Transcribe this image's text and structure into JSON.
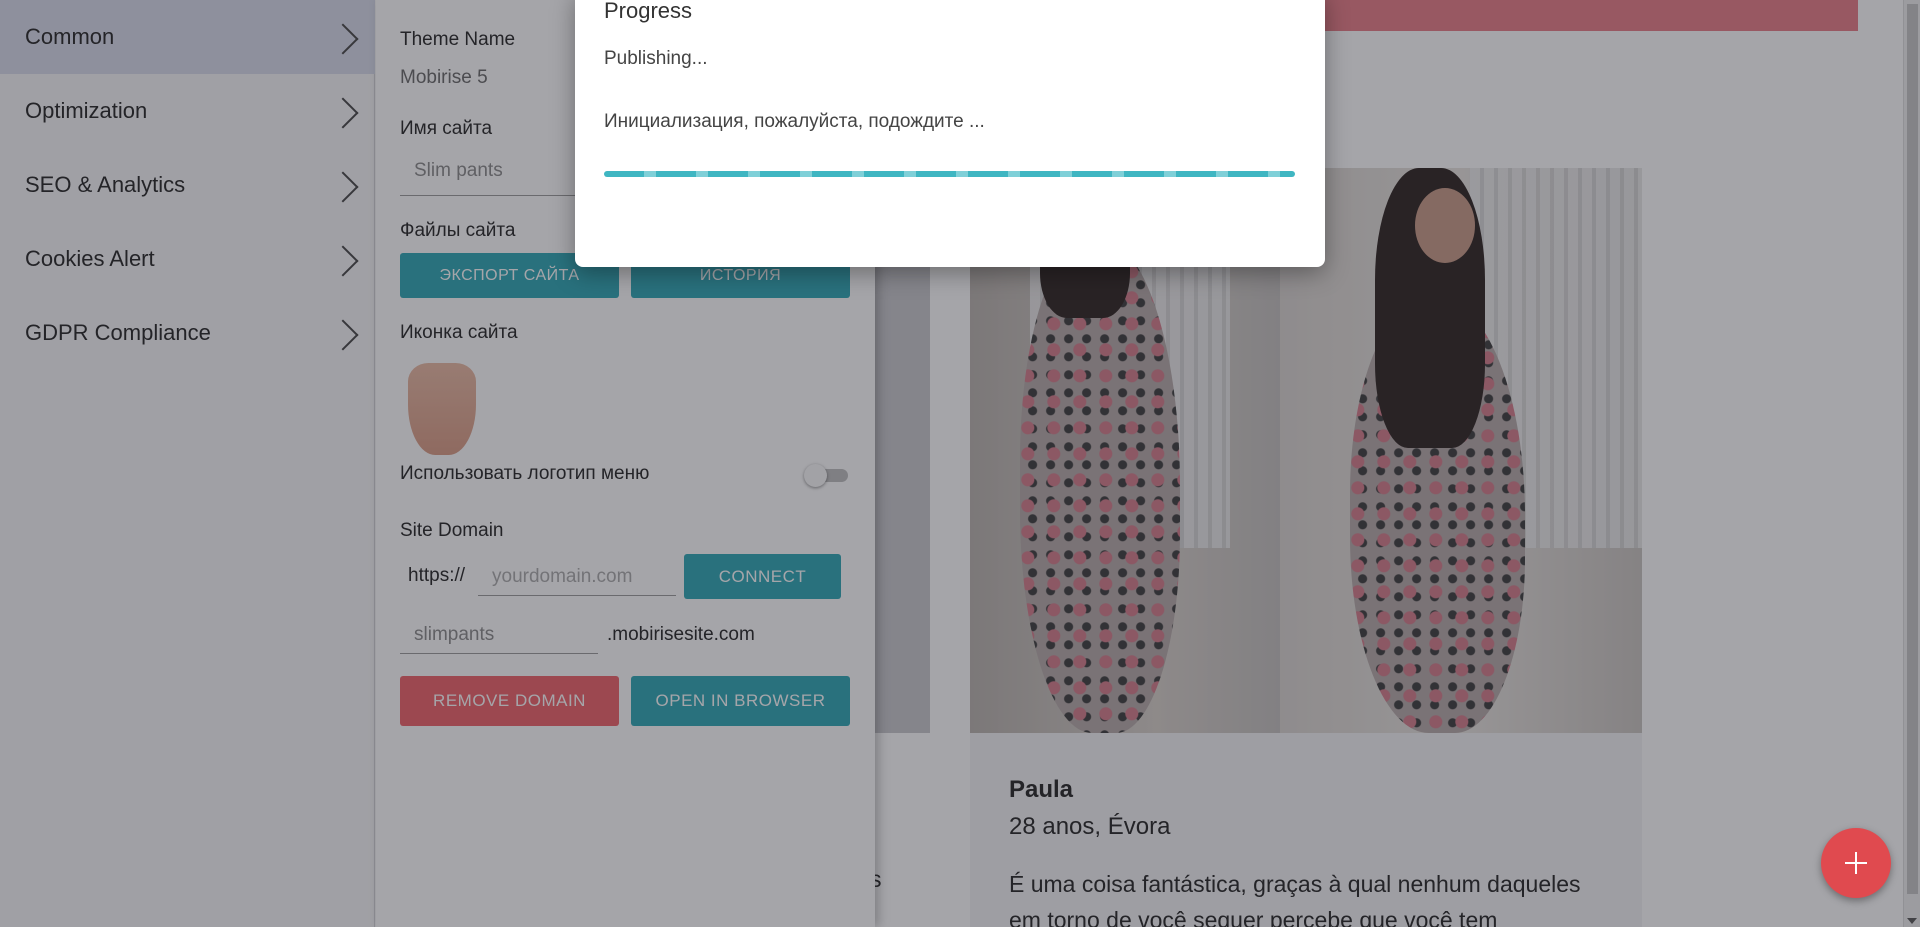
{
  "sidebar": {
    "items": [
      {
        "label": "Common",
        "active": true,
        "icon": "chevron-right-icon"
      },
      {
        "label": "Optimization",
        "active": false,
        "icon": "chevron-right-icon"
      },
      {
        "label": "SEO & Analytics",
        "active": false,
        "icon": "chevron-right-icon"
      },
      {
        "label": "Cookies Alert",
        "active": false,
        "icon": "chevron-right-icon"
      },
      {
        "label": "GDPR Compliance",
        "active": false,
        "icon": "chevron-right-icon"
      }
    ]
  },
  "settings": {
    "theme_label": "Theme Name",
    "theme_value": "Mobirise 5",
    "site_name_label": "Имя сайта",
    "site_name_value": "Slim pants",
    "site_files_label": "Файлы сайта",
    "export_button": "ЭКСПОРТ САЙТА",
    "history_button": "ИСТОРИЯ",
    "site_icon_label": "Иконка сайта",
    "use_menu_logo_label": "Использовать логотип меню",
    "use_menu_logo_on": false,
    "site_domain_label": "Site Domain",
    "domain_prefix": "https://",
    "domain_placeholder": "yourdomain.com",
    "connect_button": "CONNECT",
    "subdomain_value": "slimpants",
    "subdomain_suffix": ".mobirisesite.com",
    "remove_domain_button": "REMOVE DOMAIN",
    "open_browser_button": "OPEN IN BROWSER"
  },
  "modal": {
    "title": "Progress",
    "status": "Publishing...",
    "message": "Инициализация, пожалуйста, подождите ..."
  },
  "preview": {
    "person_name": "Paula",
    "person_meta": "28 anos, Évora",
    "quote": "É uma coisa fantástica, graças à qual nenhum daqueles em torno de você sequer percebe que você tem",
    "stray_text": "s"
  },
  "colors": {
    "accent_teal": "#2aa6b4",
    "danger_red": "#f06066",
    "fab_red": "#e04a4f",
    "active_menu_bg": "#d7dbea"
  },
  "fab": {
    "icon": "plus-icon"
  }
}
